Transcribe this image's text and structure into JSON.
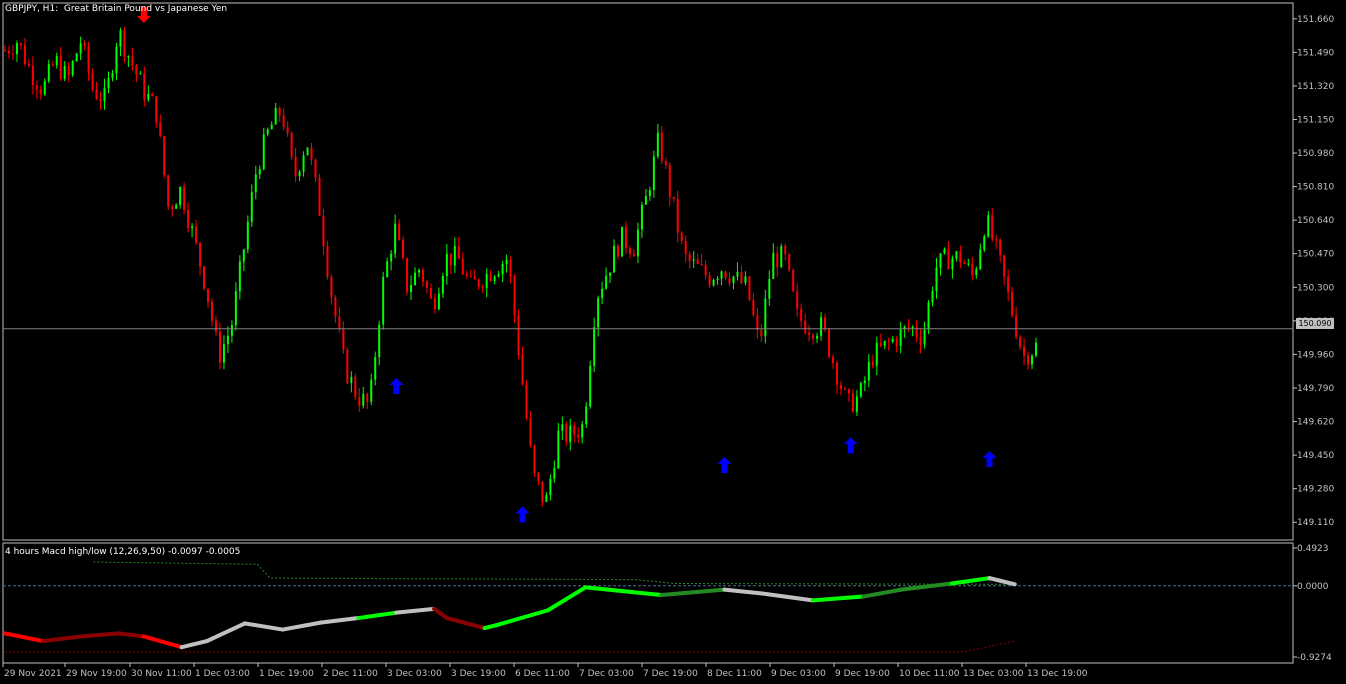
{
  "window": {
    "symbol_title": "GBPJPY, H1:  Great Britain Pound vs Japanese Yen",
    "current_price_label": "150.090"
  },
  "price_axis": {
    "labels": [
      "151.660",
      "151.490",
      "151.320",
      "151.150",
      "150.980",
      "150.810",
      "150.640",
      "150.470",
      "150.300",
      "150.130",
      "149.960",
      "149.790",
      "149.620",
      "149.450",
      "149.280",
      "149.110"
    ]
  },
  "indicator": {
    "title": "4 hours Macd high/low (12,26,9,50) -0.0097 -0.0005",
    "axis_labels": [
      "0.4923",
      "0.0000",
      "-0.9274"
    ]
  },
  "time_axis": {
    "labels": [
      "29 Nov 2021",
      "29 Nov 19:00",
      "30 Nov 11:00",
      "1 Dec 03:00",
      "1 Dec 19:00",
      "2 Dec 11:00",
      "3 Dec 03:00",
      "3 Dec 19:00",
      "6 Dec 11:00",
      "7 Dec 03:00",
      "7 Dec 19:00",
      "8 Dec 11:00",
      "9 Dec 03:00",
      "9 Dec 19:00",
      "10 Dec 11:00",
      "13 Dec 03:00",
      "13 Dec 19:00"
    ]
  },
  "colors": {
    "background": "#000000",
    "bull": "#00ff00",
    "bear": "#ff0000",
    "grid": "#333333",
    "axis_text": "#c0c0c0",
    "arrow_up": "#0000ff",
    "arrow_down": "#ff0000",
    "macd_bull": "#00ff00",
    "macd_bull_dark": "#228b22",
    "macd_bear": "#ff0000",
    "macd_bear_dark": "#8b0000",
    "macd_neutral": "#c0c0c0"
  },
  "chart_data": {
    "type": "candlestick",
    "price_path": [
      151.5,
      151.55,
      151.4,
      151.3,
      151.45,
      151.35,
      151.55,
      151.3,
      151.25,
      151.6,
      151.45,
      151.3,
      151.2,
      150.7,
      150.8,
      150.55,
      150.3,
      149.95,
      150.1,
      150.5,
      150.9,
      151.1,
      151.2,
      150.85,
      151.05,
      150.7,
      150.25,
      149.9,
      149.75,
      149.7,
      150.3,
      150.6,
      150.3,
      150.4,
      150.2,
      150.45,
      150.45,
      150.3,
      150.35,
      150.4,
      150.45,
      149.9,
      149.35,
      149.2,
      149.55,
      149.55,
      149.6,
      150.25,
      150.4,
      150.55,
      150.5,
      150.75,
      151.05,
      150.75,
      150.45,
      150.4,
      150.35,
      150.4,
      150.35,
      150.3,
      150.0,
      150.45,
      150.45,
      150.15,
      150.1,
      150.1,
      149.9,
      149.7,
      149.75,
      149.95,
      150.0,
      150.05,
      150.1,
      150.05,
      150.4,
      150.45,
      150.45,
      150.35,
      150.65,
      150.45,
      150.2,
      149.95,
      150.0
    ],
    "price_range": [
      149.02,
      151.74
    ],
    "current_price": 150.09,
    "signal_arrows": [
      {
        "direction": "down",
        "bar": 11,
        "price": 151.68
      },
      {
        "direction": "up",
        "bar": 31,
        "price": 149.8
      },
      {
        "direction": "up",
        "bar": 41,
        "price": 149.15
      },
      {
        "direction": "up",
        "bar": 57,
        "price": 149.4
      },
      {
        "direction": "up",
        "bar": 67,
        "price": 149.5
      },
      {
        "direction": "up",
        "bar": 78,
        "price": 149.43
      }
    ],
    "indicator": {
      "range": [
        -0.9274,
        0.4923
      ],
      "macd_line": [
        {
          "bar": 0,
          "value": -0.62,
          "state": "bear"
        },
        {
          "bar": 3,
          "value": -0.72,
          "state": "bear"
        },
        {
          "bar": 6,
          "value": -0.66,
          "state": "bear_dark"
        },
        {
          "bar": 9,
          "value": -0.62,
          "state": "bear_dark"
        },
        {
          "bar": 11,
          "value": -0.66,
          "state": "bear_dark"
        },
        {
          "bar": 14,
          "value": -0.8,
          "state": "bear"
        },
        {
          "bar": 16,
          "value": -0.72,
          "state": "neutral"
        },
        {
          "bar": 19,
          "value": -0.49,
          "state": "neutral"
        },
        {
          "bar": 22,
          "value": -0.57,
          "state": "neutral"
        },
        {
          "bar": 25,
          "value": -0.48,
          "state": "neutral"
        },
        {
          "bar": 28,
          "value": -0.42,
          "state": "neutral"
        },
        {
          "bar": 31,
          "value": -0.35,
          "state": "bull"
        },
        {
          "bar": 34,
          "value": -0.3,
          "state": "neutral"
        },
        {
          "bar": 35,
          "value": -0.42,
          "state": "bear_dark"
        },
        {
          "bar": 38,
          "value": -0.55,
          "state": "bear_dark"
        },
        {
          "bar": 39,
          "value": -0.51,
          "state": "bull"
        },
        {
          "bar": 43,
          "value": -0.32,
          "state": "bull"
        },
        {
          "bar": 46,
          "value": -0.02,
          "state": "bull"
        },
        {
          "bar": 52,
          "value": -0.12,
          "state": "bull"
        },
        {
          "bar": 57,
          "value": -0.05,
          "state": "bull_dark"
        },
        {
          "bar": 60,
          "value": -0.1,
          "state": "neutral"
        },
        {
          "bar": 64,
          "value": -0.19,
          "state": "neutral"
        },
        {
          "bar": 68,
          "value": -0.14,
          "state": "bull"
        },
        {
          "bar": 71,
          "value": -0.05,
          "state": "bull_dark"
        },
        {
          "bar": 75,
          "value": 0.03,
          "state": "bull_dark"
        },
        {
          "bar": 78,
          "value": 0.1,
          "state": "bull"
        },
        {
          "bar": 80,
          "value": 0.02,
          "state": "neutral"
        }
      ],
      "upper_band": [
        {
          "bar": 7,
          "value": 0.31
        },
        {
          "bar": 20,
          "value": 0.28
        },
        {
          "bar": 21,
          "value": 0.1
        },
        {
          "bar": 50,
          "value": 0.08
        },
        {
          "bar": 53,
          "value": 0.03
        },
        {
          "bar": 80,
          "value": 0.02
        }
      ],
      "lower_band": [
        {
          "bar": 0,
          "value": -0.86
        },
        {
          "bar": 76,
          "value": -0.86
        },
        {
          "bar": 80,
          "value": -0.72
        }
      ]
    }
  }
}
